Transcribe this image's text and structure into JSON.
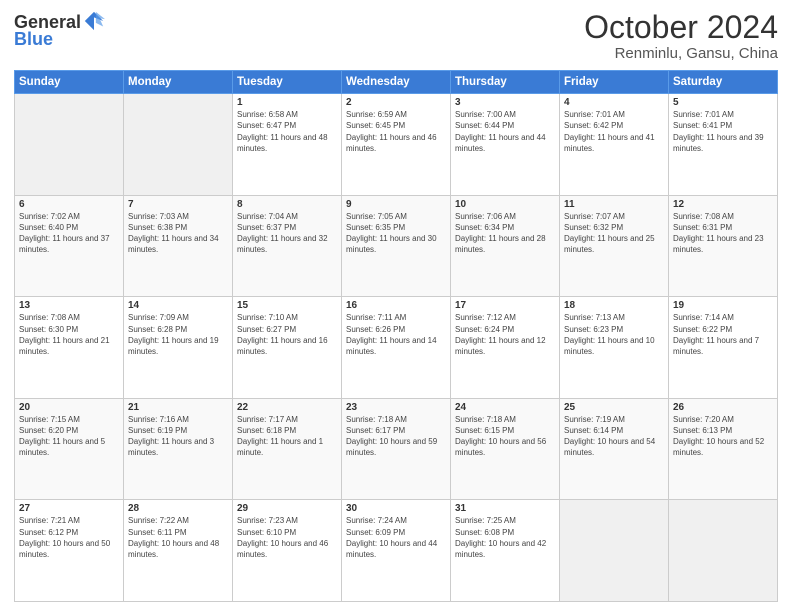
{
  "logo": {
    "general": "General",
    "blue": "Blue"
  },
  "title": "October 2024",
  "location": "Renminlu, Gansu, China",
  "days_of_week": [
    "Sunday",
    "Monday",
    "Tuesday",
    "Wednesday",
    "Thursday",
    "Friday",
    "Saturday"
  ],
  "weeks": [
    [
      {
        "day": "",
        "info": ""
      },
      {
        "day": "",
        "info": ""
      },
      {
        "day": "1",
        "info": "Sunrise: 6:58 AM\nSunset: 6:47 PM\nDaylight: 11 hours and 48 minutes."
      },
      {
        "day": "2",
        "info": "Sunrise: 6:59 AM\nSunset: 6:45 PM\nDaylight: 11 hours and 46 minutes."
      },
      {
        "day": "3",
        "info": "Sunrise: 7:00 AM\nSunset: 6:44 PM\nDaylight: 11 hours and 44 minutes."
      },
      {
        "day": "4",
        "info": "Sunrise: 7:01 AM\nSunset: 6:42 PM\nDaylight: 11 hours and 41 minutes."
      },
      {
        "day": "5",
        "info": "Sunrise: 7:01 AM\nSunset: 6:41 PM\nDaylight: 11 hours and 39 minutes."
      }
    ],
    [
      {
        "day": "6",
        "info": "Sunrise: 7:02 AM\nSunset: 6:40 PM\nDaylight: 11 hours and 37 minutes."
      },
      {
        "day": "7",
        "info": "Sunrise: 7:03 AM\nSunset: 6:38 PM\nDaylight: 11 hours and 34 minutes."
      },
      {
        "day": "8",
        "info": "Sunrise: 7:04 AM\nSunset: 6:37 PM\nDaylight: 11 hours and 32 minutes."
      },
      {
        "day": "9",
        "info": "Sunrise: 7:05 AM\nSunset: 6:35 PM\nDaylight: 11 hours and 30 minutes."
      },
      {
        "day": "10",
        "info": "Sunrise: 7:06 AM\nSunset: 6:34 PM\nDaylight: 11 hours and 28 minutes."
      },
      {
        "day": "11",
        "info": "Sunrise: 7:07 AM\nSunset: 6:32 PM\nDaylight: 11 hours and 25 minutes."
      },
      {
        "day": "12",
        "info": "Sunrise: 7:08 AM\nSunset: 6:31 PM\nDaylight: 11 hours and 23 minutes."
      }
    ],
    [
      {
        "day": "13",
        "info": "Sunrise: 7:08 AM\nSunset: 6:30 PM\nDaylight: 11 hours and 21 minutes."
      },
      {
        "day": "14",
        "info": "Sunrise: 7:09 AM\nSunset: 6:28 PM\nDaylight: 11 hours and 19 minutes."
      },
      {
        "day": "15",
        "info": "Sunrise: 7:10 AM\nSunset: 6:27 PM\nDaylight: 11 hours and 16 minutes."
      },
      {
        "day": "16",
        "info": "Sunrise: 7:11 AM\nSunset: 6:26 PM\nDaylight: 11 hours and 14 minutes."
      },
      {
        "day": "17",
        "info": "Sunrise: 7:12 AM\nSunset: 6:24 PM\nDaylight: 11 hours and 12 minutes."
      },
      {
        "day": "18",
        "info": "Sunrise: 7:13 AM\nSunset: 6:23 PM\nDaylight: 11 hours and 10 minutes."
      },
      {
        "day": "19",
        "info": "Sunrise: 7:14 AM\nSunset: 6:22 PM\nDaylight: 11 hours and 7 minutes."
      }
    ],
    [
      {
        "day": "20",
        "info": "Sunrise: 7:15 AM\nSunset: 6:20 PM\nDaylight: 11 hours and 5 minutes."
      },
      {
        "day": "21",
        "info": "Sunrise: 7:16 AM\nSunset: 6:19 PM\nDaylight: 11 hours and 3 minutes."
      },
      {
        "day": "22",
        "info": "Sunrise: 7:17 AM\nSunset: 6:18 PM\nDaylight: 11 hours and 1 minute."
      },
      {
        "day": "23",
        "info": "Sunrise: 7:18 AM\nSunset: 6:17 PM\nDaylight: 10 hours and 59 minutes."
      },
      {
        "day": "24",
        "info": "Sunrise: 7:18 AM\nSunset: 6:15 PM\nDaylight: 10 hours and 56 minutes."
      },
      {
        "day": "25",
        "info": "Sunrise: 7:19 AM\nSunset: 6:14 PM\nDaylight: 10 hours and 54 minutes."
      },
      {
        "day": "26",
        "info": "Sunrise: 7:20 AM\nSunset: 6:13 PM\nDaylight: 10 hours and 52 minutes."
      }
    ],
    [
      {
        "day": "27",
        "info": "Sunrise: 7:21 AM\nSunset: 6:12 PM\nDaylight: 10 hours and 50 minutes."
      },
      {
        "day": "28",
        "info": "Sunrise: 7:22 AM\nSunset: 6:11 PM\nDaylight: 10 hours and 48 minutes."
      },
      {
        "day": "29",
        "info": "Sunrise: 7:23 AM\nSunset: 6:10 PM\nDaylight: 10 hours and 46 minutes."
      },
      {
        "day": "30",
        "info": "Sunrise: 7:24 AM\nSunset: 6:09 PM\nDaylight: 10 hours and 44 minutes."
      },
      {
        "day": "31",
        "info": "Sunrise: 7:25 AM\nSunset: 6:08 PM\nDaylight: 10 hours and 42 minutes."
      },
      {
        "day": "",
        "info": ""
      },
      {
        "day": "",
        "info": ""
      }
    ]
  ]
}
